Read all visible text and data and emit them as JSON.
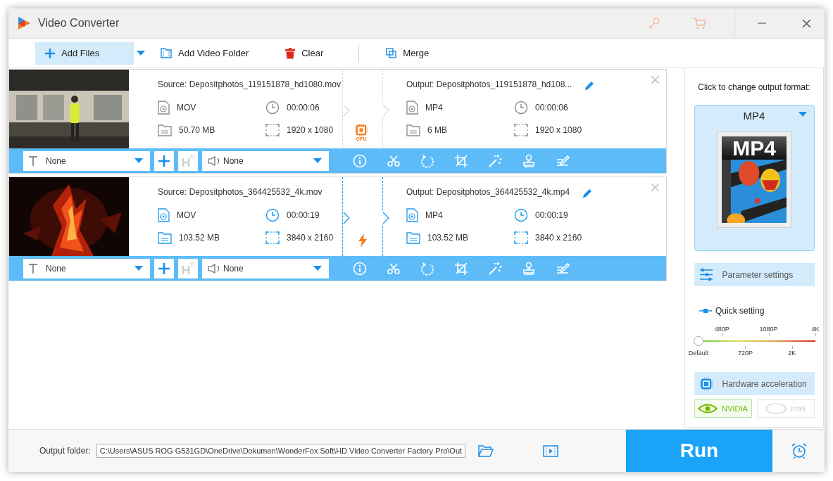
{
  "window": {
    "title": "Video Converter"
  },
  "toolbar": [
    {
      "label": "Add Files",
      "kind": "add",
      "selected": true
    },
    {
      "label": "Add Video Folder",
      "kind": "folder",
      "selected": false
    },
    {
      "label": "Clear",
      "kind": "clear",
      "selected": false
    },
    {
      "label": "Merge",
      "kind": "merge",
      "selected": false
    }
  ],
  "files": [
    {
      "selected": false,
      "kind": "gpu",
      "accel_label": "GPU",
      "source": "Source: Depositphotos_119151878_hd1080.mov",
      "source_format": "MOV",
      "source_duration": "00:00:06",
      "source_size": "50.70 MB",
      "source_resolution": "1920 x 1080",
      "output": "Output: Depositphotos_119151878_hd108...",
      "output_format": "MP4",
      "output_duration": "00:00:06",
      "output_size": "6 MB",
      "output_resolution": "1920 x 1080",
      "subtitle": "None",
      "audio": "None"
    },
    {
      "selected": true,
      "kind": "lightning",
      "source": "Source: Depositphotos_364425532_4k.mov",
      "source_format": "MOV",
      "source_duration": "00:00:19",
      "source_size": "103.52 MB",
      "source_resolution": "3840 x 2160",
      "output": "Output: Depositphotos_364425532_4k.mp4",
      "output_format": "MP4",
      "output_duration": "00:00:19",
      "output_size": "103.52 MB",
      "output_resolution": "3840 x 2160",
      "subtitle": "None",
      "audio": "None"
    }
  ],
  "output_panel": {
    "hint": "Click to change output format:",
    "format": "MP4",
    "format_icon_label": "MP4",
    "parameter_button": "Parameter settings",
    "quick_setting": "Quick setting",
    "quality_slider": {
      "level": 0,
      "ticks": [
        "Default",
        "480P",
        "720P",
        "1080P",
        "2K",
        "4K"
      ]
    },
    "hardware_button": "Hardware acceleration",
    "hardware": [
      {
        "label": "NVIDIA",
        "kind": "nvidia",
        "selected": true,
        "disabled": false
      },
      {
        "label": "Intel",
        "kind": "intel",
        "selected": false,
        "disabled": true
      }
    ]
  },
  "bottom_bar": {
    "output_folder_label": "Output folder:",
    "output_folder": "C:\\Users\\ASUS ROG G531GD\\OneDrive\\Dokumen\\WonderFox Soft\\HD Video Converter Factory Pro\\Out",
    "run_button": "Run"
  }
}
